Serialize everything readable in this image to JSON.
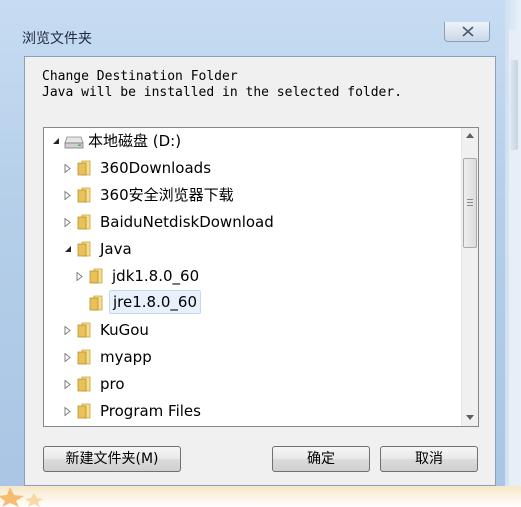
{
  "window": {
    "title": "浏览文件夹",
    "close_label": "×"
  },
  "description": {
    "line1": "Change Destination Folder",
    "line2": "Java will be installed in the selected folder."
  },
  "tree": {
    "root": "本地磁盘 (D:)",
    "items": [
      {
        "label": "360Downloads",
        "expanded": false
      },
      {
        "label": "360安全浏览器下载",
        "expanded": false
      },
      {
        "label": "BaiduNetdiskDownload",
        "expanded": false
      },
      {
        "label": "Java",
        "expanded": true
      },
      {
        "label": "jdk1.8.0_60",
        "expanded": false
      },
      {
        "label": "jre1.8.0_60",
        "selected": true
      },
      {
        "label": "KuGou",
        "expanded": false
      },
      {
        "label": "myapp",
        "expanded": false
      },
      {
        "label": "pro",
        "expanded": false
      },
      {
        "label": "Program Files",
        "expanded": false
      }
    ]
  },
  "buttons": {
    "new_folder": "新建文件夹(M)",
    "ok": "确定",
    "cancel": "取消"
  },
  "colors": {
    "folder": "#e8c15a",
    "frame": "#b5cfe9",
    "selection": "#e8f1fb"
  }
}
